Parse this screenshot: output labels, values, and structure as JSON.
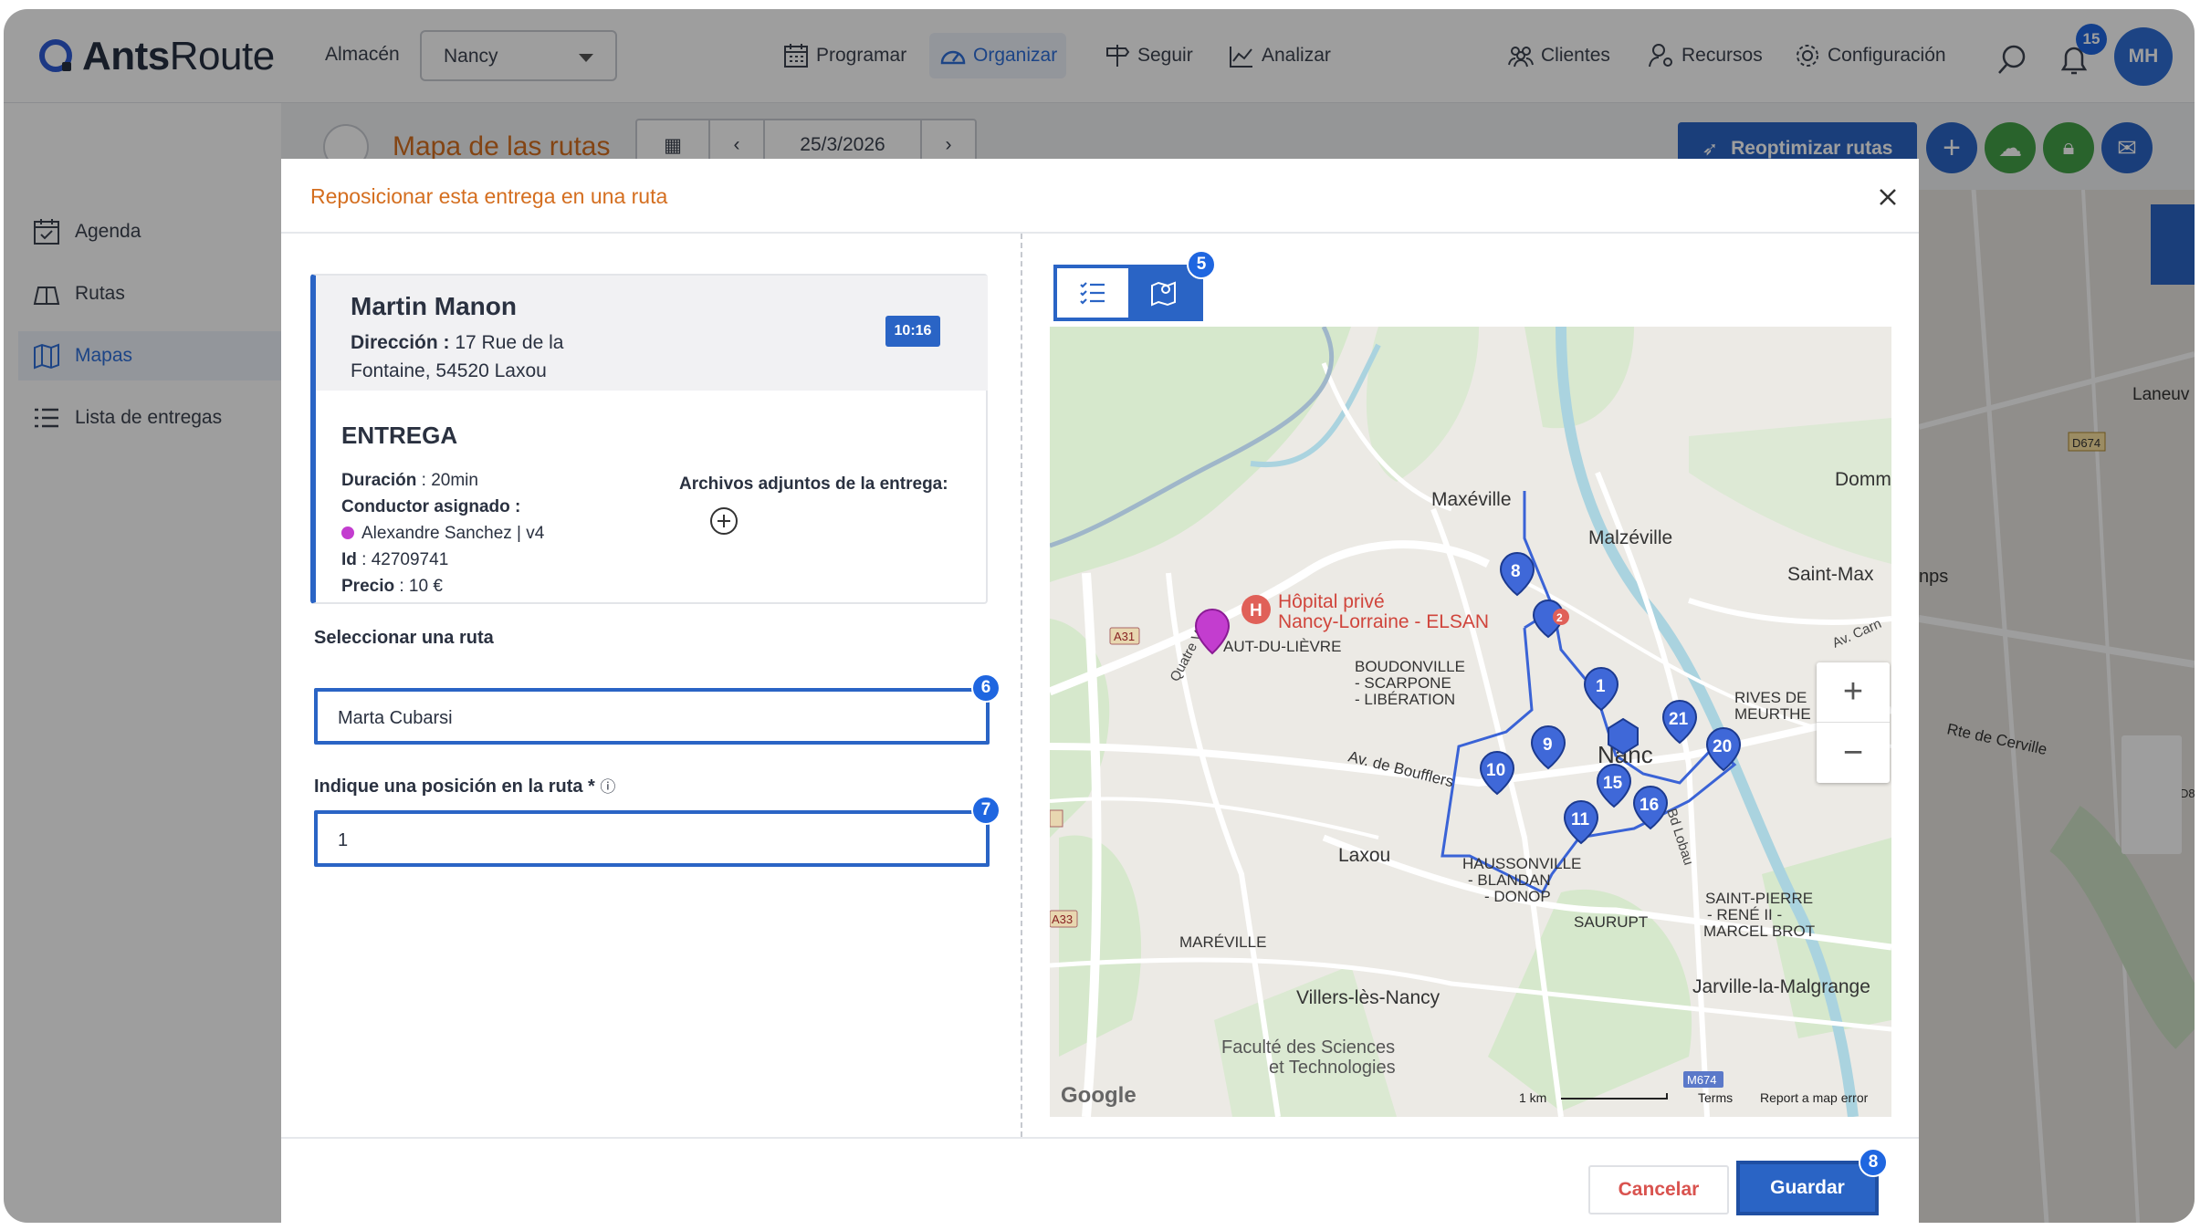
{
  "app": {
    "brand_bold": "Ants",
    "brand_light": "Route"
  },
  "header": {
    "warehouse_label": "Almacén",
    "warehouse_value": "Nancy",
    "nav": [
      {
        "label": "Programar"
      },
      {
        "label": "Organizar"
      },
      {
        "label": "Seguir"
      },
      {
        "label": "Analizar"
      },
      {
        "label": "Clientes"
      },
      {
        "label": "Recursos"
      },
      {
        "label": "Configuración"
      }
    ],
    "notifications": "15",
    "avatar": "MH"
  },
  "sidebar": {
    "items": [
      {
        "label": "Agenda"
      },
      {
        "label": "Rutas"
      },
      {
        "label": "Mapas"
      },
      {
        "label": "Lista de entregas"
      }
    ]
  },
  "page": {
    "title": "Mapa de las rutas",
    "date": "25/3/2026",
    "reoptimize": "Reoptimizar rutas"
  },
  "modal": {
    "title": "Reposicionar esta entrega en una ruta",
    "customer": "Martin Manon",
    "address_label": "Dirección :",
    "address_value": " 17 Rue de la Fontaine, 54520 Laxou",
    "time": "10:16",
    "section": "ENTREGA",
    "duration_label": "Duración",
    "duration_value": " : 20min",
    "driver_label": "Conductor asignado :",
    "driver_value": "Alexandre Sanchez | v4",
    "id_label": "Id",
    "id_value": " : 42709741",
    "price_label": "Precio",
    "price_value": " : 10 €",
    "attachments_label": "Archivos adjuntos de la entrega:",
    "route_label": "Seleccionar una ruta",
    "route_value": "Marta Cubarsi",
    "position_label": "Indique una posición en la ruta *",
    "position_value": "1",
    "cancel": "Cancelar",
    "save": "Guardar",
    "steps": [
      "5",
      "6",
      "7",
      "8"
    ]
  },
  "map": {
    "places": [
      "Maxéville",
      "Malzéville",
      "Saint-Max",
      "Domm",
      "Hôpital privé",
      "Nancy-Lorraine - ELSAN",
      "AUT-DU-LIÈVRE",
      "BOUDONVILLE",
      "- SCARPONE",
      "- LIBÉRATION",
      "RIVES DE",
      "MEURTHE",
      "Av. de Boufflers",
      "Laxou",
      "HAUSSONVILLE",
      "- BLANDAN",
      "- DONOP",
      "SAURUPT",
      "SAINT-PIERRE",
      "- RENÉ II -",
      "MARCEL BROT",
      "MARÉVILLE",
      "Villers-lès-Nancy",
      "Jarville-la-Malgrange",
      "Faculté des Sciences",
      "et Technologies",
      "Quatre Vents",
      "Bd Lobau",
      "Av. Carn",
      "Nanc"
    ],
    "roads": [
      "A31",
      "A33",
      "M674"
    ],
    "markers": [
      "8",
      "1",
      "21",
      "20",
      "9",
      "10",
      "15",
      "16",
      "11",
      "2"
    ],
    "scale": "1 km",
    "terms": "Terms",
    "report": "Report a map error",
    "google": "Google"
  },
  "bgmap": {
    "labels": [
      "Laneuv",
      "D674",
      "nps",
      "Rte de Cerville",
      "D8"
    ]
  }
}
